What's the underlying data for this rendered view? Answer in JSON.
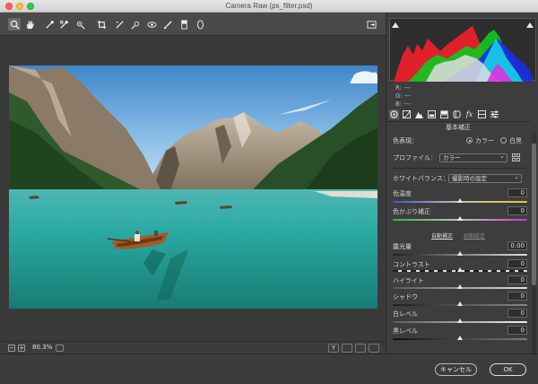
{
  "window": {
    "title": "Camera Raw (ps_filter.psd)"
  },
  "toolbar": {
    "tools": [
      "zoom-icon",
      "hand-icon",
      "eyedropper-icon",
      "color-sampler-icon",
      "targeted-adjust-icon",
      "crop-icon",
      "straighten-icon",
      "spot-removal-icon",
      "redeye-icon",
      "brush-icon",
      "graduated-filter-icon",
      "radial-filter-icon"
    ],
    "open_prefs": "open-dialog-icon"
  },
  "status": {
    "zoom": "80.3%",
    "view_y": "Y"
  },
  "readout": {
    "r": "R:   ---",
    "g": "G:   ---",
    "b": "B:   ---"
  },
  "panel": {
    "title": "基本補正",
    "treatment_label": "色表現：",
    "treatment_color": "カラー",
    "treatment_bw": "白黒",
    "profile_label": "プロファイル：",
    "profile_value": "カラー",
    "wb_label": "ホワイトバランス：",
    "wb_value": "撮影時の設定",
    "temp_label": "色温度",
    "temp_value": "0",
    "tint_label": "色かぶり補正",
    "tint_value": "0",
    "auto_link": "自動補正",
    "default_link": "初期設定",
    "exposure_label": "露光量",
    "exposure_value": "0.00",
    "contrast_label": "コントラスト",
    "contrast_value": "0",
    "highlights_label": "ハイライト",
    "highlights_value": "0",
    "shadows_label": "シャドウ",
    "shadows_value": "0",
    "whites_label": "白レベル",
    "whites_value": "0",
    "blacks_label": "黒レベル",
    "blacks_value": "0"
  },
  "footer": {
    "cancel": "キャンセル",
    "ok": "OK"
  },
  "colors": {
    "accent_link": "#dcdcdc",
    "inactive_link": "#8a8a8a"
  }
}
